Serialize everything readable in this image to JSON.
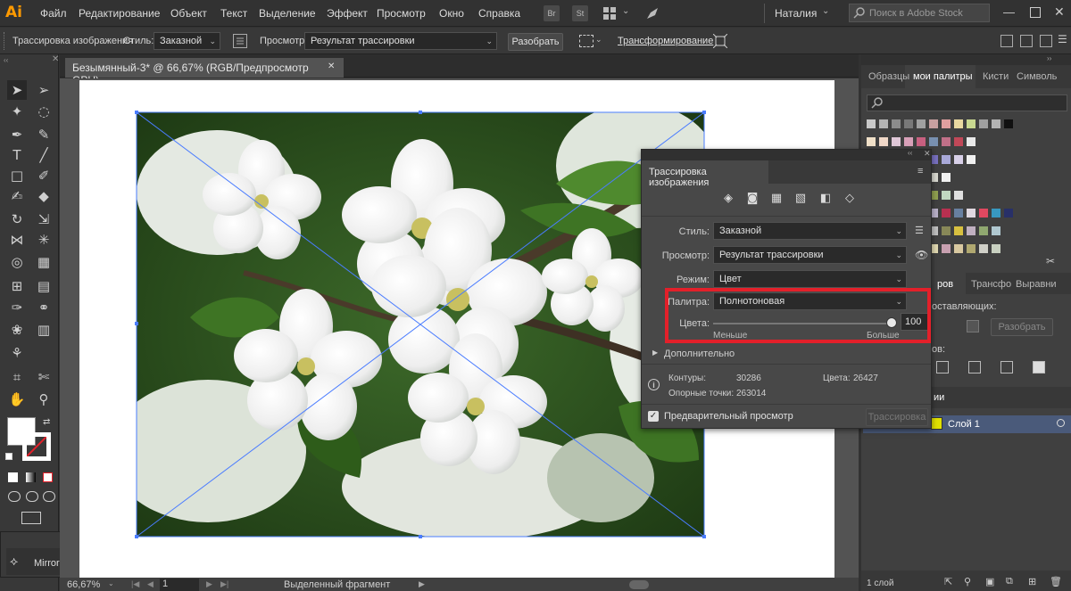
{
  "app": {
    "logo": "Ai",
    "accent": "#ff9a00"
  },
  "menu": [
    "Файл",
    "Редактирование",
    "Объект",
    "Текст",
    "Выделение",
    "Эффект",
    "Просмотр",
    "Окно",
    "Справка"
  ],
  "menu_icons": [
    "bridge-icon",
    "stock-icon",
    "workspace-grid-icon",
    "rocket-icon"
  ],
  "menu_icon_labels": {
    "br": "Br",
    "st": "St"
  },
  "user": "Наталия",
  "search": {
    "placeholder": "Поиск в Adobe Stock"
  },
  "controlbar": {
    "title": "Трассировка изображения",
    "style_label": "Стиль:",
    "style_value": "Заказной",
    "preview_label": "Просмотр:",
    "preview_value": "Результат трассировки",
    "expand_button": "Разобрать",
    "transform_link": "Трансформирование"
  },
  "document": {
    "tab_title": "Безымянный-3* @ 66,67% (RGB/Предпросмотр GPU)",
    "close": "✕"
  },
  "status": {
    "zoom": "66,67%",
    "page": "1",
    "selection": "Выделенный фрагмент"
  },
  "right_panel": {
    "tabs": [
      "Образцы",
      "мои палитры",
      "Кисти",
      "Символь"
    ],
    "tabs2": [
      "ров",
      "Трансфо",
      "Выравни"
    ],
    "align_label": "оставляющих:",
    "expand_button": "Разобрать",
    "pathfinder_label": "ов:",
    "layers_tab": "ии",
    "layer_name": "Слой 1",
    "layers_count": "1 слой"
  },
  "swatches": {
    "row1": [
      "#c8c8c8",
      "#b4b4b4",
      "#8c8c8c",
      "#787878",
      "#a0a0a0",
      "#c8a0a0",
      "#e0a0a0",
      "#e8d8a0",
      "#c8d890",
      "#a0a0a0",
      "#b4b4b4",
      "#101010"
    ],
    "row2": [
      "#f0e0c8",
      "#f0d8c8",
      "#e0c8d8",
      "#d8a0b8",
      "#c86080",
      "#7890b0",
      "#c07088",
      "#c04858",
      "#e8e8e8"
    ],
    "row3": [
      "#a0a0a0",
      "#b0c060",
      "#7080b8",
      "#6040a0",
      "#8068a0",
      "#7870c0",
      "#a8a8d8",
      "#d8d0e8",
      "#f0f0f0"
    ],
    "row4": [
      "#e04858",
      "#c06058",
      "#c8b040",
      "#a88840",
      "#e0c860",
      "#d8d8d0",
      "#f0f0f0"
    ],
    "row5": [
      "#d8d8d8",
      "#d0c040",
      "#607030",
      "#405838",
      "#789050",
      "#90a050",
      "#c0d8c0",
      "#e0e0e0"
    ],
    "row6": [
      "#c0c0c0",
      "#e03850",
      "#30a0b0",
      "#508890",
      "#308070",
      "#b8b0c8",
      "#b83050",
      "#6880a0",
      "#e0d8e0",
      "#e04860",
      "#3898c0",
      "#283068"
    ],
    "row7": [
      "#a8a8a8",
      "#2d2d2d",
      "#307060",
      "#507860",
      "#c890a0",
      "#c0c0c0",
      "#888858",
      "#d8c040",
      "#c0b0c0",
      "#90a870",
      "#b0c8d0"
    ],
    "row8": [
      "#909090",
      "#204838",
      "#404858",
      "#c08090",
      "#a0a070",
      "#e0d8b0",
      "#c8a0b0",
      "#d8c8a0",
      "#b0a870",
      "#d0d0c8",
      "#c8d0c0"
    ]
  },
  "trace_panel": {
    "title": "Трассировка изображения",
    "presets": [
      "auto-color-icon",
      "high-color-icon",
      "low-color-icon",
      "grayscale-icon",
      "black-white-icon",
      "outline-icon"
    ],
    "style_label": "Стиль:",
    "style_value": "Заказной",
    "view_label": "Просмотр:",
    "view_value": "Результат трассировки",
    "mode_label": "Режим:",
    "mode_value": "Цвет",
    "palette_label": "Палитра:",
    "palette_value": "Полнотоновая",
    "colors_label": "Цвета:",
    "colors_value": "100",
    "colors_level": 1.0,
    "less": "Меньше",
    "more": "Больше",
    "advanced": "Дополнительно",
    "paths_label": "Контуры:",
    "paths_value": "30286",
    "colors_count_label": "Цвета:",
    "colors_count_value": "26427",
    "anchors_label": "Опорные точки:",
    "anchors_value": "263014",
    "preview_checkbox": "Предварительный просмотр",
    "trace_button": "Трассировка",
    "highlight_color": "#e3202a"
  },
  "mini_panel": {
    "label": "Mirror..."
  }
}
